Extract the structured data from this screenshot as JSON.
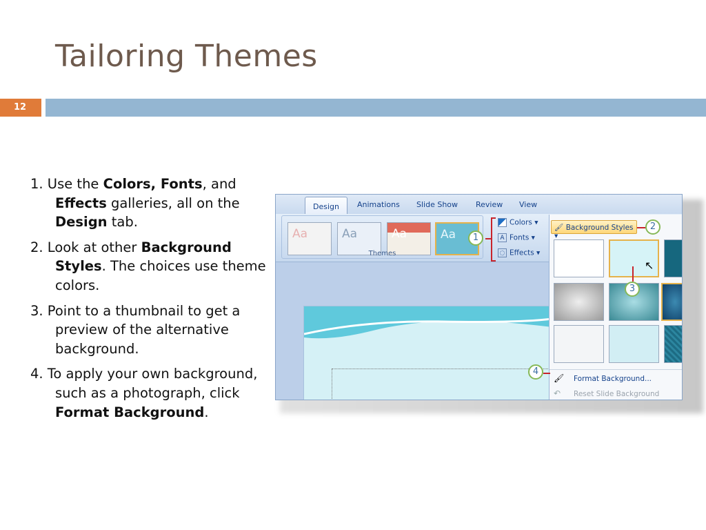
{
  "slide": {
    "title": "Tailoring Themes",
    "number": "12",
    "accent_color": "#e07b39",
    "bar_color": "#94b6d2",
    "title_color": "#6e5a4d"
  },
  "steps": [
    {
      "n": "1. Use the ",
      "b1": "Colors, Fonts",
      "t1": ", and ",
      "b2": "Effects",
      "t2": " galleries, all on the ",
      "b3": "Design",
      "t3": " tab."
    },
    {
      "n": "2. Look at other ",
      "b1": "Background Styles",
      "t1": ". The choices use theme colors."
    },
    {
      "n": "3. Point to a thumbnail to get a preview of the alternative background."
    },
    {
      "n": "4. To apply your own background, such as a photograph, click ",
      "b1": "Format Background",
      "t1": "."
    }
  ],
  "screenshot": {
    "tabs": [
      "Design",
      "Animations",
      "Slide Show",
      "Review",
      "View"
    ],
    "thumb_text": [
      "Aa",
      "Aa",
      "Aa",
      "Aa"
    ],
    "themes_label": "Themes",
    "buttons": {
      "colors": "Colors",
      "fonts": "Fonts",
      "effects": "Effects"
    },
    "icons": {
      "colors": "colors-icon",
      "fonts": "fonts-icon",
      "effects": "effects-icon"
    },
    "bg_styles": "Background Styles",
    "callouts": [
      "1",
      "2",
      "3",
      "4"
    ],
    "menu": {
      "format": "Format Background...",
      "reset": "Reset Slide Background"
    }
  }
}
